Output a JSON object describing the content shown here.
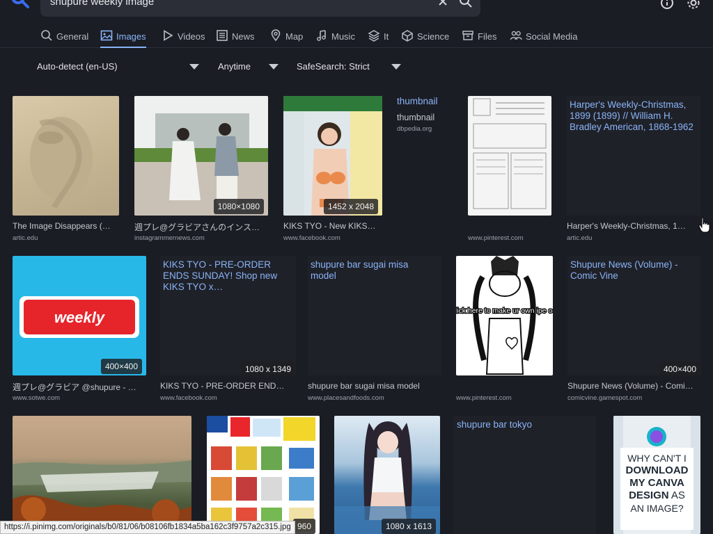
{
  "search": {
    "query": "shupure weekly image"
  },
  "tabs": [
    {
      "label": "General",
      "icon": "search-icon"
    },
    {
      "label": "Images",
      "icon": "image-icon"
    },
    {
      "label": "Videos",
      "icon": "play-icon"
    },
    {
      "label": "News",
      "icon": "newspaper-icon"
    },
    {
      "label": "Map",
      "icon": "map-pin-icon"
    },
    {
      "label": "Music",
      "icon": "music-note-icon"
    },
    {
      "label": "It",
      "icon": "layers-icon"
    },
    {
      "label": "Science",
      "icon": "cube-icon"
    },
    {
      "label": "Files",
      "icon": "archive-icon"
    },
    {
      "label": "Social Media",
      "icon": "people-icon"
    }
  ],
  "filters": {
    "language": "Auto-detect (en-US)",
    "time": "Anytime",
    "safesearch": "SafeSearch: Strict"
  },
  "colors": {
    "accent": "#8ab4f8",
    "background": "#1b1d24"
  },
  "results": {
    "r1": {
      "caption": "The Image Disappears (…",
      "source": "artic.edu"
    },
    "r2": {
      "caption": "週プレ@グラビアさんのインス…",
      "source": "instagrammernews.com",
      "dims": "1080×1080"
    },
    "r3": {
      "caption": "KIKS TYO - New KIKS…",
      "source": "www.facebook.com",
      "dims": "1452 x 2048"
    },
    "r4": {
      "title": "thumbnail",
      "caption": "thumbnail",
      "source": "dbpedia.org"
    },
    "r5": {
      "source": "www.pinterest.com"
    },
    "r6": {
      "title": "Harper's Weekly-Christmas, 1899 (1899) // William H. Bradley American, 1868-1962",
      "caption": "Harper's Weekly-Christmas, 1…",
      "source": "artic.edu"
    },
    "r7": {
      "caption": "週プレ@グラビア @shupure - …",
      "source": "www.sotwe.com",
      "dims": "400×400",
      "logo_text": "weekly"
    },
    "r8": {
      "title": "KIKS TYO - PRE-ORDER ENDS SUNDAY! Shop new KIKS TYO x…",
      "caption": "KIKS TYO - PRE-ORDER END…",
      "source": "www.facebook.com",
      "dims": "1080 x 1349"
    },
    "r9": {
      "title": "shupure bar sugai misa model",
      "caption": "shupure bar sugai misa model",
      "source": "www.placesandfoods.com"
    },
    "r10": {
      "source": "www.pinterest.com",
      "overlay": "click here to make ur own ipe oc!"
    },
    "r11": {
      "title": "Shupure News (Volume) - Comic Vine",
      "caption": "Shupure News (Volume) - Comi…",
      "source": "comicvine.gamespot.com",
      "dims": "400×400"
    },
    "r12": {},
    "r13": {
      "dims": "960"
    },
    "r14": {
      "dims": "1080 x 1613"
    },
    "r15": {
      "title": "shupure bar tokyo"
    },
    "r16": {
      "line1": "WHY CAN'T I",
      "line2": "DOWNLOAD",
      "line3": "MY CANVA",
      "line4": "DESIGN",
      "line4b": "AS",
      "line5": "AN IMAGE?"
    }
  },
  "status_url": "https://i.pinimg.com/originals/b0/81/06/b08106fb1834a5ba162c3f9757a2c315.jpg"
}
